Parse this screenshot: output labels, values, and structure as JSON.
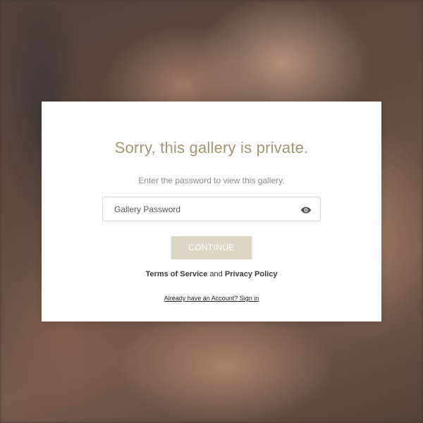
{
  "dialog": {
    "title": "Sorry, this gallery is private.",
    "subtitle": "Enter the password to view this gallery.",
    "password": {
      "placeholder": "Gallery Password",
      "value": "",
      "toggle_icon": "eye-icon"
    },
    "continue_label": "CONTINUE",
    "legal": {
      "terms_label": "Terms of Service",
      "conjunction": "and",
      "privacy_label": "Privacy Policy"
    },
    "signin_label": "Already have an Account? Sign in"
  },
  "colors": {
    "title": "#a49670",
    "button_bg": "#dcd6c6",
    "button_text": "#ffffff"
  }
}
